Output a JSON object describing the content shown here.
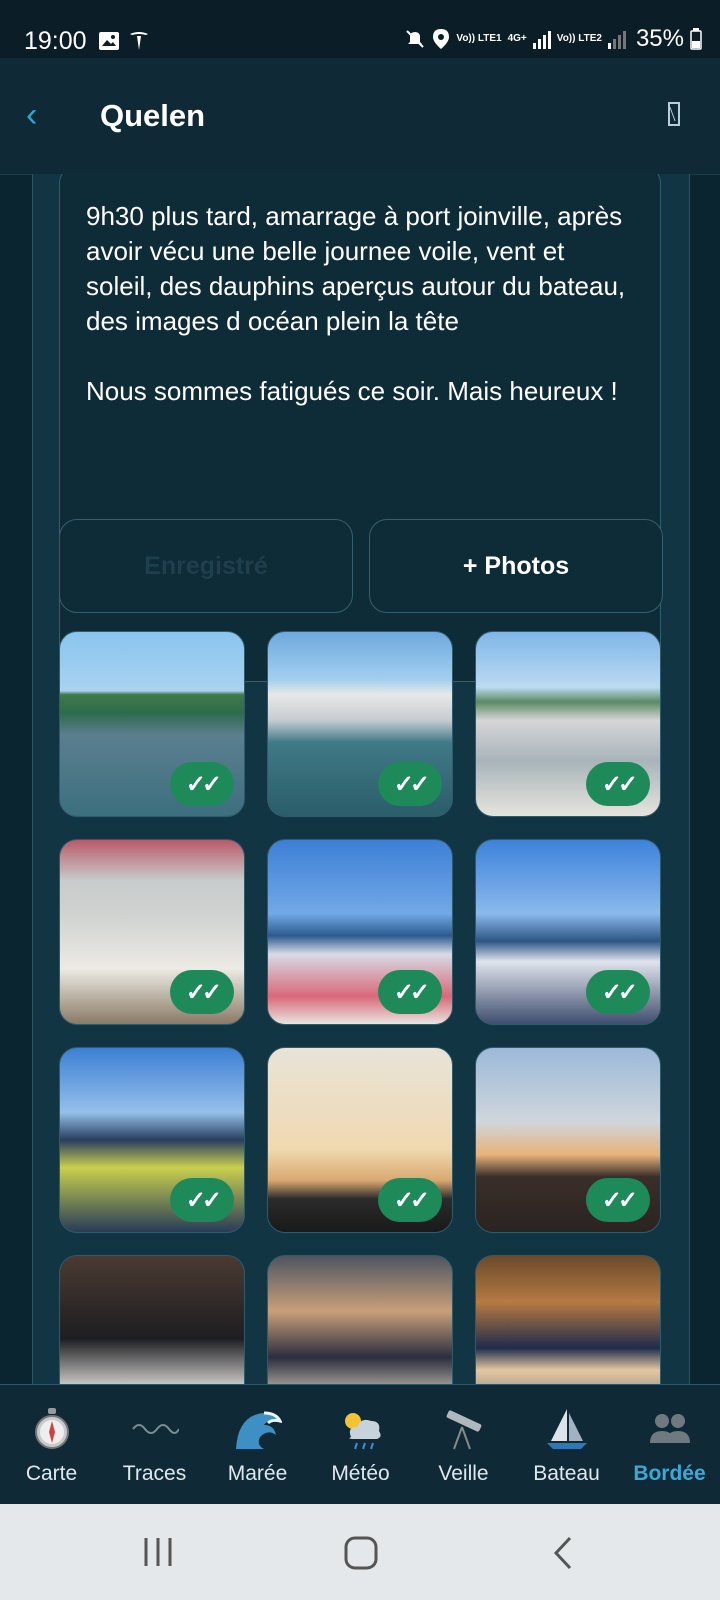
{
  "status_bar": {
    "time": "19:00",
    "network_1": "Vo)) LTE1",
    "network_2": "4G+",
    "network_3": "Vo)) LTE2",
    "battery": "35%"
  },
  "header": {
    "back_label": "‹",
    "title": "Quelen"
  },
  "entry": {
    "text": "9h30 plus tard, amarrage à port joinville, après avoir vécu une belle journee voile, vent et soleil, des dauphins aperçus autour du bateau, des images d océan plein la tête\n\nNous sommes fatigués ce soir. Mais heureux !"
  },
  "buttons": {
    "saved_label": "Enregistré",
    "photos_label": "+ Photos"
  },
  "photos": {
    "check_label": "✓✓",
    "items": [
      {
        "id": "harbor-bridge",
        "synced": true
      },
      {
        "id": "marina-masts",
        "synced": true
      },
      {
        "id": "bow-pulpit",
        "synced": true
      },
      {
        "id": "deck-anchor",
        "synced": true
      },
      {
        "id": "woman-bow",
        "synced": true
      },
      {
        "id": "woman-thumbs-up",
        "synced": true
      },
      {
        "id": "man-sunglasses",
        "synced": true
      },
      {
        "id": "masts-sunset",
        "synced": true
      },
      {
        "id": "woman-sunset",
        "synced": true
      },
      {
        "id": "child-drawing",
        "synced": false
      },
      {
        "id": "child-writing",
        "synced": false
      },
      {
        "id": "man-book",
        "synced": false
      }
    ]
  },
  "bottom_nav": [
    {
      "label": "Carte",
      "icon": "compass-icon",
      "active": false
    },
    {
      "label": "Traces",
      "icon": "wave-line-icon",
      "active": false
    },
    {
      "label": "Marée",
      "icon": "wave-icon",
      "active": false
    },
    {
      "label": "Météo",
      "icon": "weather-icon",
      "active": false
    },
    {
      "label": "Veille",
      "icon": "telescope-icon",
      "active": false
    },
    {
      "label": "Bateau",
      "icon": "sailboat-icon",
      "active": false
    },
    {
      "label": "Bordée",
      "icon": "crew-icon",
      "active": true
    }
  ],
  "colors": {
    "accent": "#3aa9d8",
    "check_badge": "#1e8a5a",
    "background": "#0a2430"
  }
}
